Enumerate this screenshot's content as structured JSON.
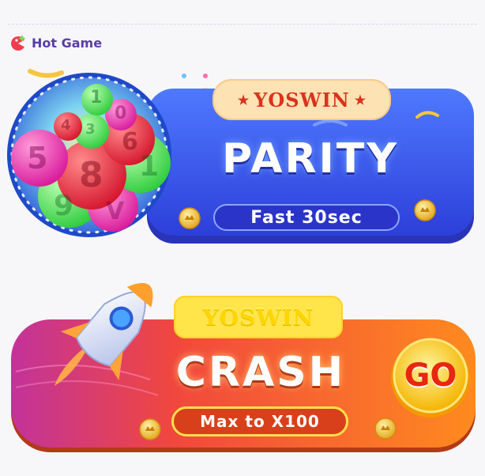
{
  "section": {
    "title": "Hot Game",
    "icon": "game-icon"
  },
  "games": [
    {
      "brand": "YOSWIN",
      "title": "PARITY",
      "subtitle": "Fast 30sec",
      "accent": "#3a5bf0",
      "art": "lottery-balls-icon"
    },
    {
      "brand": "YOSWIN",
      "title": "CRASH",
      "subtitle": "Max to X100",
      "accent": "#f26b1d",
      "art": "rocket-icon",
      "go_label": "GO"
    }
  ],
  "ball_numbers": [
    "1",
    "0",
    "4",
    "3",
    "5",
    "6",
    "8",
    "1",
    "9",
    "V"
  ]
}
